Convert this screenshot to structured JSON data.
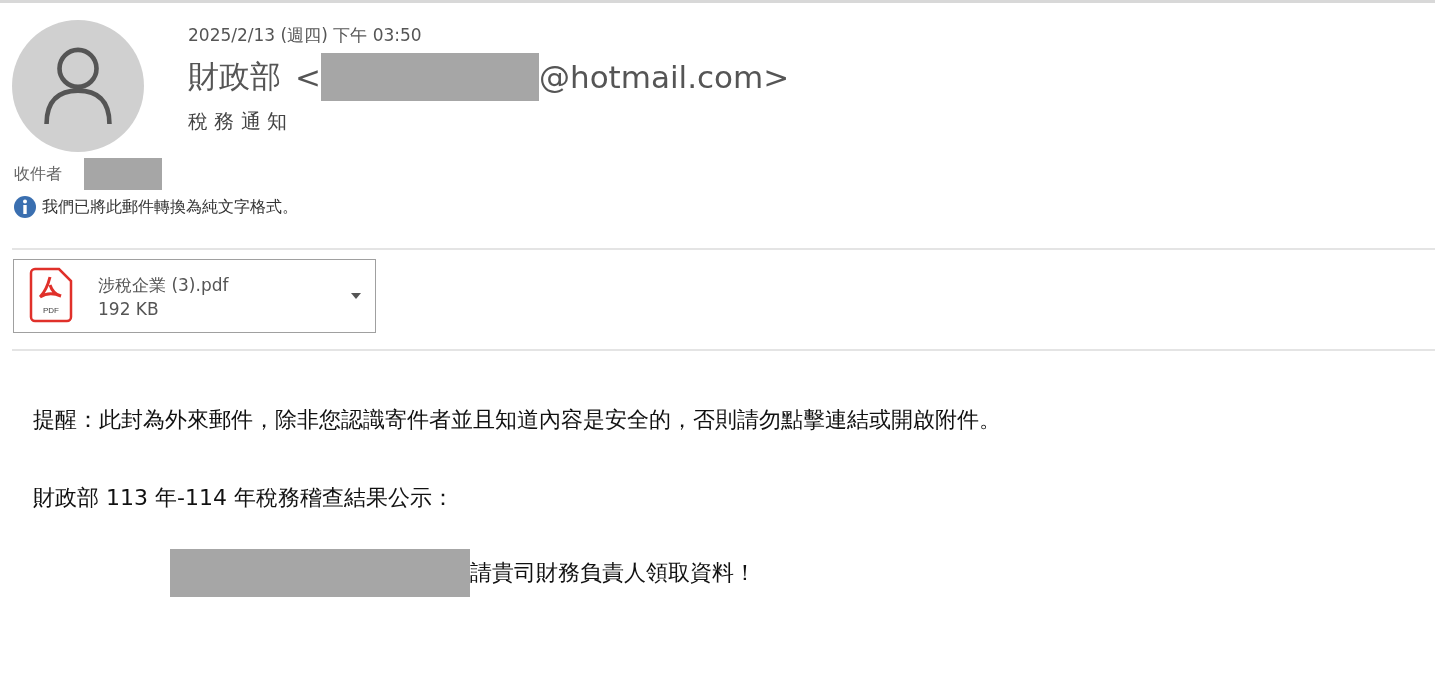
{
  "header": {
    "date": "2025/2/13 (週四) 下午 03:50",
    "sender_name": "財政部",
    "sender_email": {
      "open": "<",
      "redacted": true,
      "domain": "@hotmail.com>"
    },
    "subject": "稅 務 通 知",
    "recipient": {
      "label": "收件者",
      "redacted": true
    },
    "info": "我們已將此郵件轉換為純文字格式。"
  },
  "attachments": [
    {
      "icon_label": "PDF",
      "name": "涉稅企業 (3).pdf",
      "size": "192 KB"
    }
  ],
  "body": [
    {
      "text": "提醒：此封為外來郵件，除非您認識寄件者並且知道內容是安全的，否則請勿點擊連結或開啟附件。",
      "redacted_prefix": false
    },
    {
      "text": "財政部 113 年-114 年稅務稽查結果公示：",
      "redacted_prefix": false
    },
    {
      "text": "請貴司財務負責人領取資料！",
      "redacted_prefix": true
    }
  ]
}
